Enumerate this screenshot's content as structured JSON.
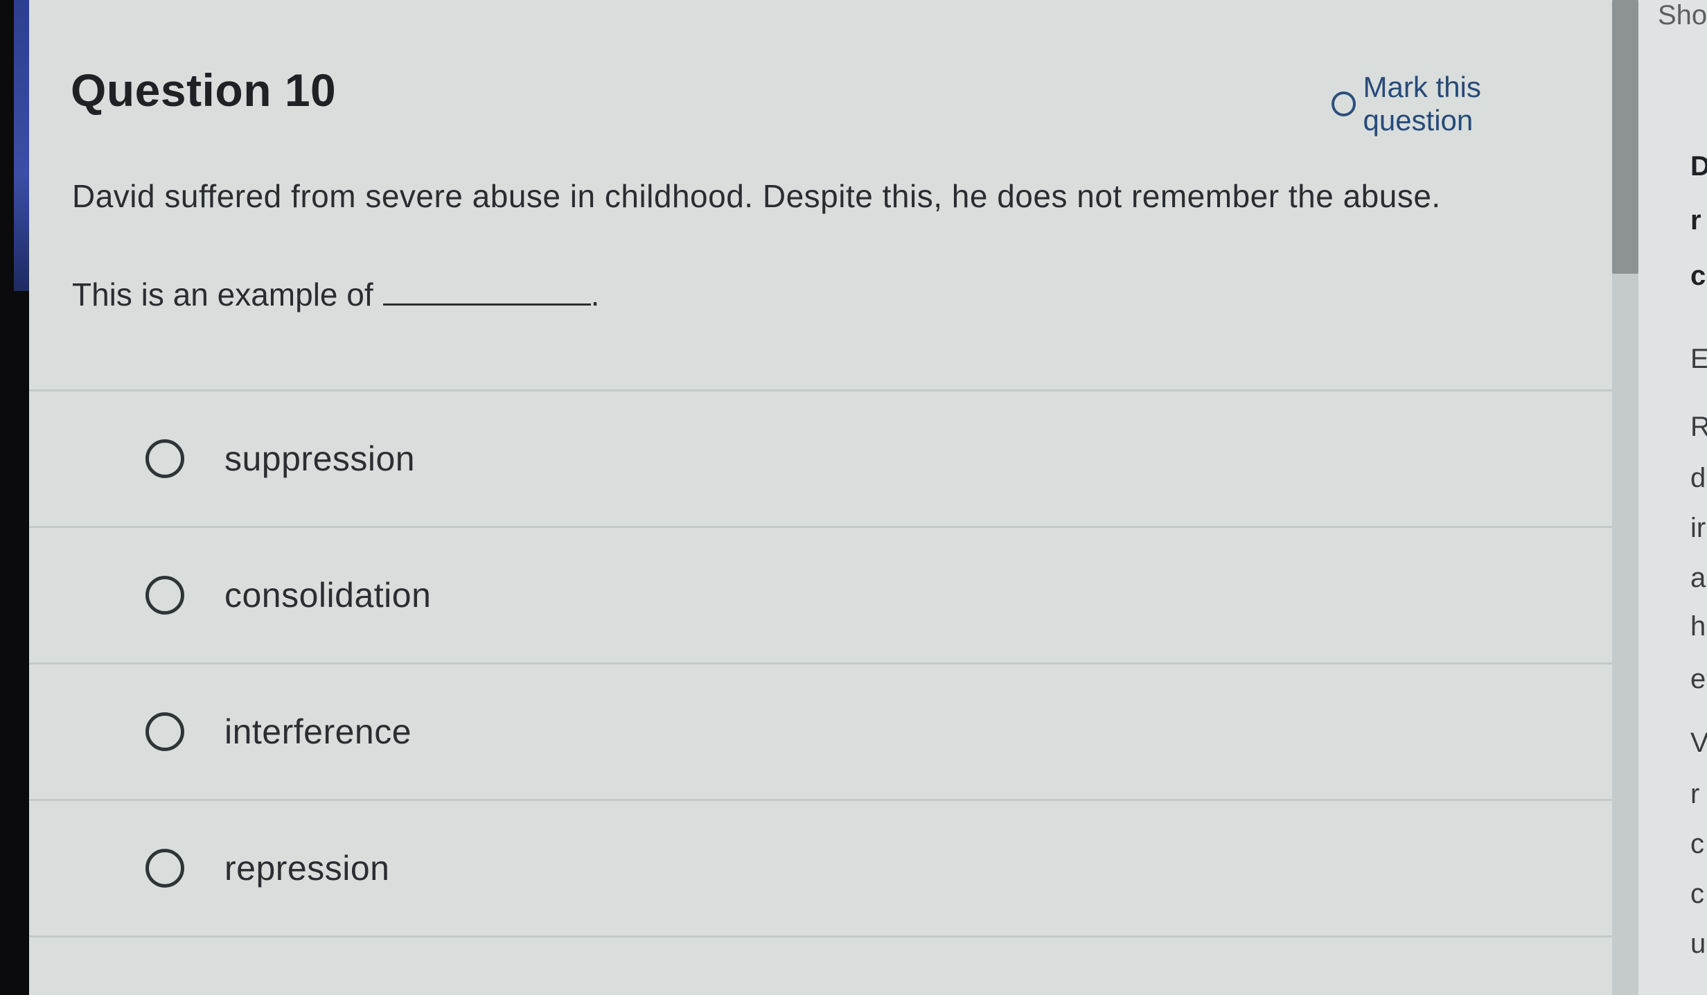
{
  "question": {
    "title": "Question 10",
    "mark_label": "Mark this question",
    "stem": "David suffered from severe abuse in childhood. Despite this, he does not remember the abuse.",
    "prompt": "This is an example of",
    "prompt_end": "."
  },
  "answers": [
    {
      "label": "suppression",
      "selected": false
    },
    {
      "label": "consolidation",
      "selected": false
    },
    {
      "label": "interference",
      "selected": false
    },
    {
      "label": "repression",
      "selected": false
    }
  ],
  "side_panel": {
    "header": "Sho",
    "fragments": [
      "D",
      "r",
      "c",
      "E",
      "R",
      "d",
      "ir",
      "a",
      "h",
      "e",
      "V",
      "r",
      "c",
      "c",
      "u"
    ]
  },
  "colors": {
    "accent": "#274a78",
    "text": "#2a2d2f",
    "background": "#d9dedd"
  }
}
